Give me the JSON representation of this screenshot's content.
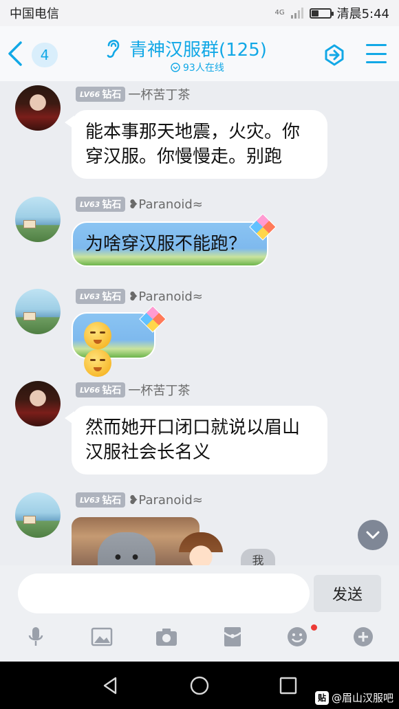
{
  "status_bar": {
    "carrier": "中国电信",
    "network": "4G",
    "time": "清晨5:44"
  },
  "header": {
    "unread_count": "4",
    "title": "青神汉服群(125)",
    "online_text": "93人在线",
    "accent_color": "#12a8e6"
  },
  "messages": [
    {
      "level": "LV66",
      "rank": "钻石",
      "name": "一杯苦丁茶",
      "text_lines": [
        "能本事那天地震，火灾。你",
        "穿汉服。你慢慢走。别跑"
      ]
    },
    {
      "level": "LV63",
      "rank": "钻石",
      "name": "❥Paranoid≈",
      "text": "为啥穿汉服不能跑？"
    },
    {
      "level": "LV63",
      "rank": "钻石",
      "name": "❥Paranoid≈",
      "emoji": [
        "annoyed-face",
        "annoyed-face"
      ]
    },
    {
      "level": "LV66",
      "rank": "钻石",
      "name": "一杯苦丁茶",
      "text_lines": [
        "然而她开口闭口就说以眉山",
        "汉服社会长名义"
      ]
    },
    {
      "level": "LV63",
      "rank": "钻石",
      "name": "❥Paranoid≈",
      "image": "cat-photo"
    }
  ],
  "me_label": "我",
  "input": {
    "placeholder": "",
    "send_label": "发送"
  },
  "toolbar": [
    "microphone-icon",
    "picture-icon",
    "camera-icon",
    "red-packet-icon",
    "emoji-icon",
    "plus-icon"
  ],
  "watermark": {
    "logo": "贴",
    "text": "@眉山汉服吧"
  }
}
